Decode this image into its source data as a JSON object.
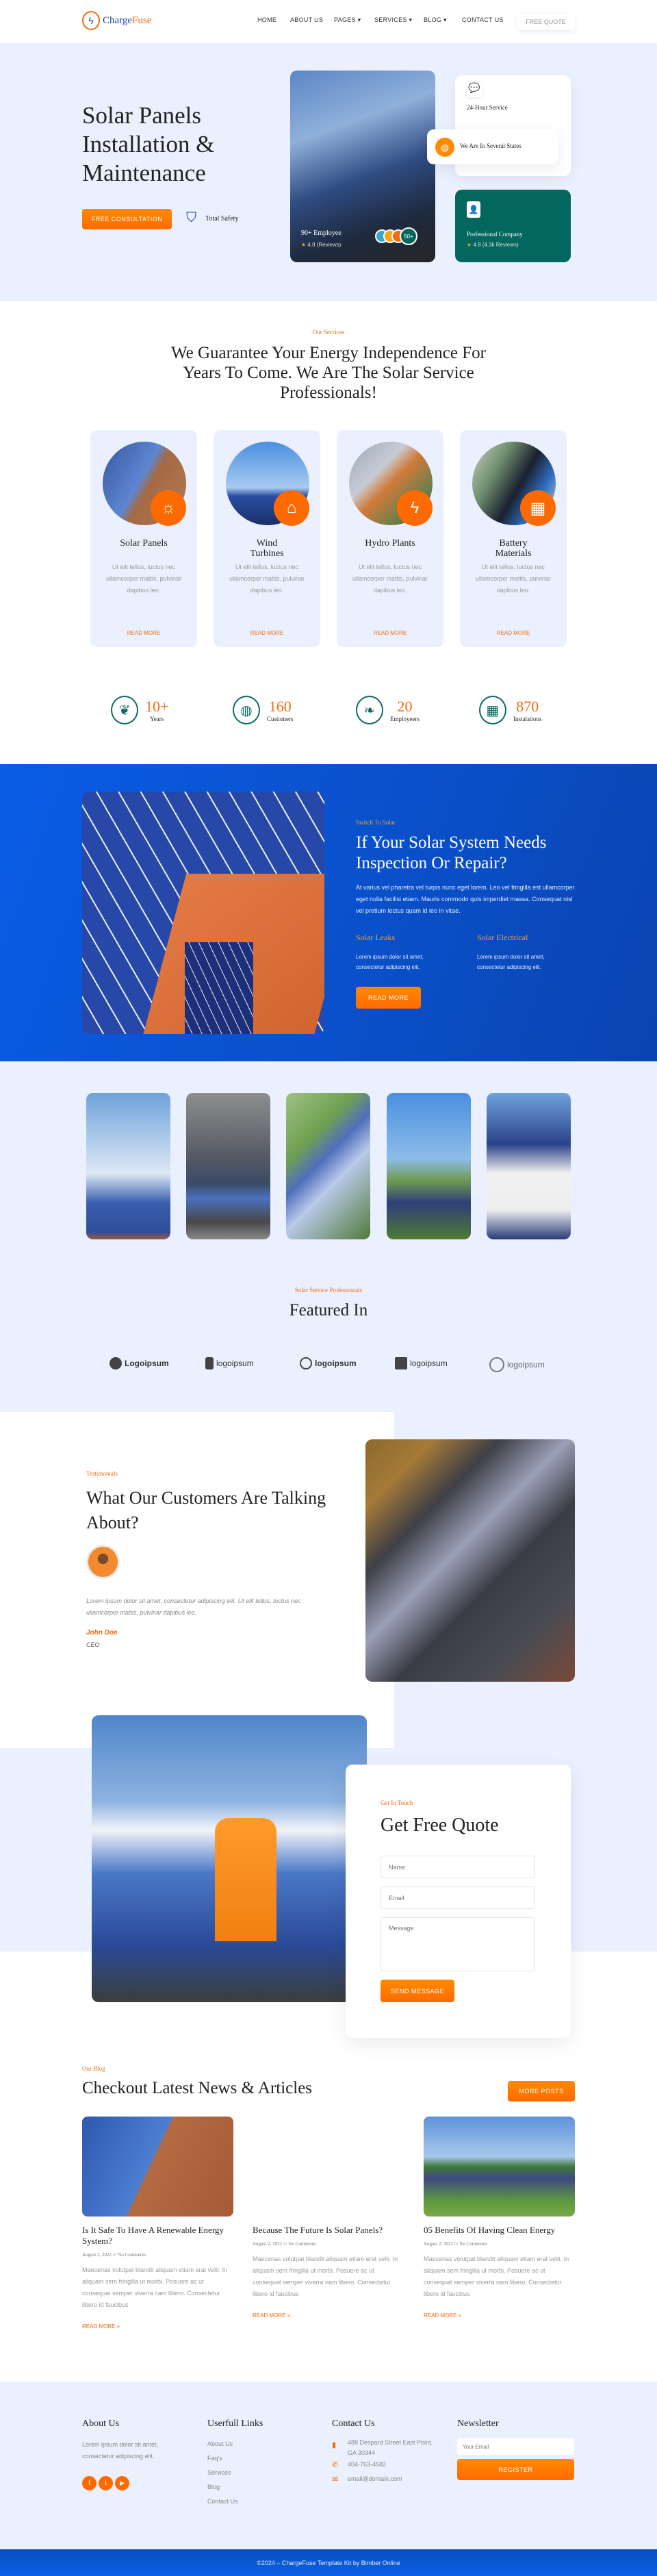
{
  "header": {
    "logo": "ChargeFuse",
    "logo_a": "Charge",
    "logo_b": "Fuse",
    "nav": [
      "HOME",
      "ABOUT US",
      "PAGES ▾",
      "SERVICES ▾",
      "BLOG ▾",
      "CONTACT US"
    ],
    "cta": "FREE QUOTE"
  },
  "hero": {
    "title_lines": [
      "Solar Panels",
      "Installation &",
      "Maintenance"
    ],
    "cta": "FREE CONSULTATION",
    "safety": "Total Safety",
    "employee": "90+ Employee",
    "employee_rating": "4.8 (Reviews)",
    "avatar_badge": "50+",
    "service": "24-Hour Service",
    "states": "We Are In Several States",
    "company": "Professional Company",
    "company_rating": "4.8 (4.3k Reviews)"
  },
  "services": {
    "label": "Our Services",
    "title": "We Guarantee Your Energy Independence For Years To Come. We Are The Solar Service Professionals!",
    "cards": [
      {
        "title": "Solar Panels",
        "text": "Ut elit tellus, luctus nec ullamcorper mattis, pulvinar dapibus leo.",
        "link": "READ MORE",
        "icon": "sun-icon"
      },
      {
        "title": "Wind Turbines",
        "text": "Ut elit tellus, luctus nec ullamcorper mattis, pulvinar dapibus leo.",
        "link": "READ MORE",
        "icon": "solar-house-icon"
      },
      {
        "title": "Hydro Plants",
        "text": "Ut elit tellus, luctus nec ullamcorper mattis, pulvinar dapibus leo.",
        "link": "READ MORE",
        "icon": "energy-bolt-icon"
      },
      {
        "title": "Battery Materials",
        "text": "Ut elit tellus, luctus nec ullamcorper mattis, pulvinar dapibus leo.",
        "link": "READ MORE",
        "icon": "solar-panel-icon"
      }
    ]
  },
  "stats": [
    {
      "value": "10+",
      "label": "Years",
      "icon": "leaf-cycle-icon"
    },
    {
      "value": "160",
      "label": "Customers",
      "icon": "globe-hand-icon"
    },
    {
      "value": "20",
      "label": "Employeers",
      "icon": "leaf-plug-icon"
    },
    {
      "value": "870",
      "label": "Instalations",
      "icon": "solar-gear-icon"
    }
  ],
  "inspection": {
    "label": "Switch To Solar",
    "title": "If Your Solar System Needs Inspection Or Repair?",
    "text": "At varius vel pharetra vel turpis nunc eget lorem. Leo vel fringilla est ullamcorper eget nulla facilisi etiam. Mauris commodo quis imperdiet massa. Consequat nisl vel pretium lectus quam id leo in vitae.",
    "features": [
      {
        "title": "Solar Leaks",
        "text": "Lorem ipsum dolor sit amet, consectetur adipiscing elit."
      },
      {
        "title": "Solar Electrical",
        "text": "Lorem ipsum dolor sit amet, consectetur adipiscing elit."
      }
    ],
    "cta": "READ MORE"
  },
  "featured": {
    "label": "Solar Service Professionals",
    "title": "Featured In",
    "logos": [
      "Logoipsum",
      "logoipsum",
      "logoipsum",
      "logoipsum",
      "logoipsum"
    ]
  },
  "testimonial": {
    "label": "Testimonials",
    "title": "What Our Customers Are Talking About?",
    "quote": "Lorem ipsum dolor sit amet, consectetur adipiscing elit. Ut elit tellus, luctus nec ullamcorper mattis, pulvinar dapibus leo.",
    "name": "John Doe",
    "role": "CEO"
  },
  "quote": {
    "label": "Get In Touch",
    "title": "Get Free Quote",
    "name_ph": "Name",
    "email_ph": "Email",
    "message_ph": "Message",
    "submit": "SEND MESSAGE"
  },
  "blog": {
    "label": "Our Blog",
    "title": "Checkout Latest News & Articles",
    "more": "MORE POSTS",
    "posts": [
      {
        "title": "Is It Safe To Have A Renewable Energy System?",
        "meta": "August 2, 2022 /// No Comments",
        "text": "Maecenas volutpat blandit aliquam etiam erat velit. In aliquam sem fringilla ut morbi. Posuere ac ut consequat semper viverra nam libero. Consectetur libero id faucibus",
        "link": "READ MORE »"
      },
      {
        "title": "Because The Future Is Solar Panels?",
        "meta": "August 2, 2022 /// No Comments",
        "text": "Maecenas volutpat blandit aliquam etiam erat velit. In aliquam sem fringilla ut morbi. Posuere ac ut consequat semper viverra nam libero. Consectetur libero id faucibus",
        "link": "READ MORE »"
      },
      {
        "title": "05 Benefits Of Having Clean Energy",
        "meta": "August 2, 2022 /// No Comments",
        "text": "Maecenas volutpat blandit aliquam etiam erat velit. In aliquam sem fringilla ut morbi. Posuere ac ut consequat semper viverra nam libero. Consectetur libero id faucibus",
        "link": "READ MORE »"
      }
    ]
  },
  "footer": {
    "about_h": "About Us",
    "about_text": "Lorem ipsum dolor sit amet, consectetur adipiscing elit.",
    "links_h": "Userfull Links",
    "links": [
      "About Us",
      "Faq's",
      "Services",
      "Blog",
      "Contact Us"
    ],
    "contact_h": "Contact Us",
    "address": "488 Despard Street East Point, GA 30344",
    "phone": "404-763-4582",
    "email": "email@domain.com",
    "news_h": "Newsletter",
    "email_ph": "Your Email",
    "register": "REGISTER",
    "copyright": "©2024 – ChargeFuse Template Kit by Bimber Online"
  },
  "colors": {
    "accent": "#FF6A00",
    "blue": "#0A55D6",
    "teal": "#03675F",
    "light": "#EAF0FD"
  }
}
